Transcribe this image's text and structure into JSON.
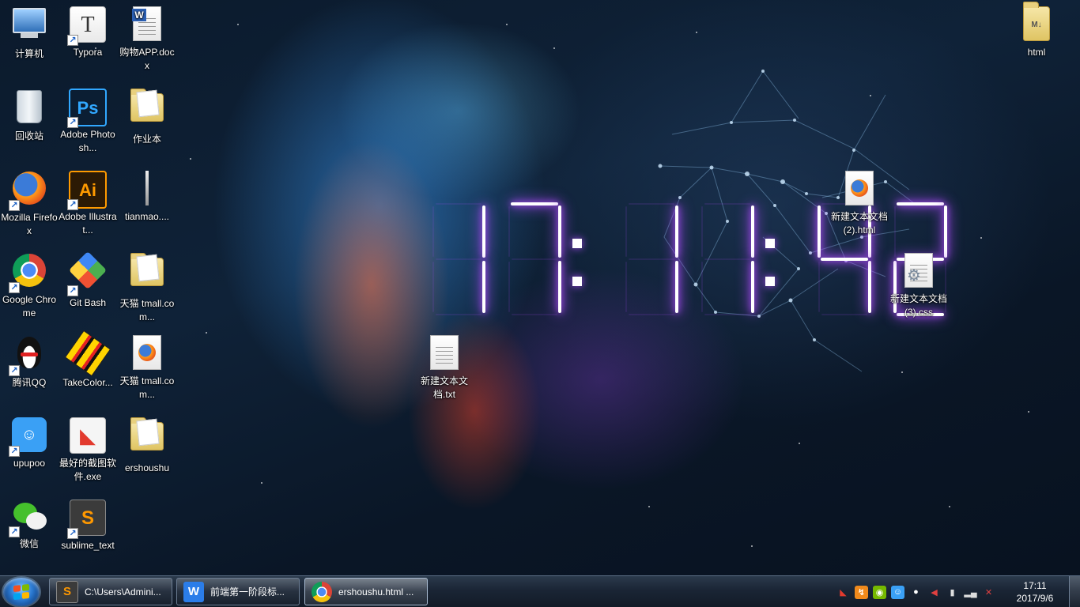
{
  "clock_display": {
    "hours": "17",
    "minutes": "11",
    "seconds": "42"
  },
  "desktop_icons": {
    "computer": "计算机",
    "typora": "Typora",
    "docx": "购物APP.docx",
    "recycle": "回收站",
    "photoshop": "Adobe Photosh...",
    "homework": "作业本",
    "firefox": "Mozilla Firefox",
    "illustrator": "Adobe Illustrat...",
    "tianmao_file": "tianmao....",
    "chrome": "Google Chrome",
    "gitbash": "Git Bash",
    "tmall_folder": "天猫 tmall.com...",
    "qq": "腾讯QQ",
    "takecolor": "TakeColor...",
    "tmall_html": "天猫 tmall.com...",
    "upupoo": "upupoo",
    "screenshot": "最好的截图软件.exe",
    "ershoushu": "ershoushu",
    "wechat": "微信",
    "sublime": "sublime_text",
    "html_folder": "html",
    "new_html": "新建文本文档 (2).html",
    "new_css": "新建文本文档 (3).css",
    "new_txt": "新建文本文档.txt"
  },
  "taskbar": {
    "buttons": [
      {
        "label": "C:\\Users\\Admini...",
        "icon": "sublime-icon",
        "color": "#f08a1c"
      },
      {
        "label": "前端第一阶段标...",
        "icon": "wps-icon",
        "color": "#2b7de9"
      },
      {
        "label": "ershoushu.html ...",
        "icon": "chrome-icon",
        "color": "#dd4b39"
      }
    ],
    "time": "17:11",
    "date": "2017/9/6"
  },
  "colors": {
    "clock_segment": "#ffffff",
    "clock_glow": "#b04cff",
    "network": "#9fd3ff"
  }
}
